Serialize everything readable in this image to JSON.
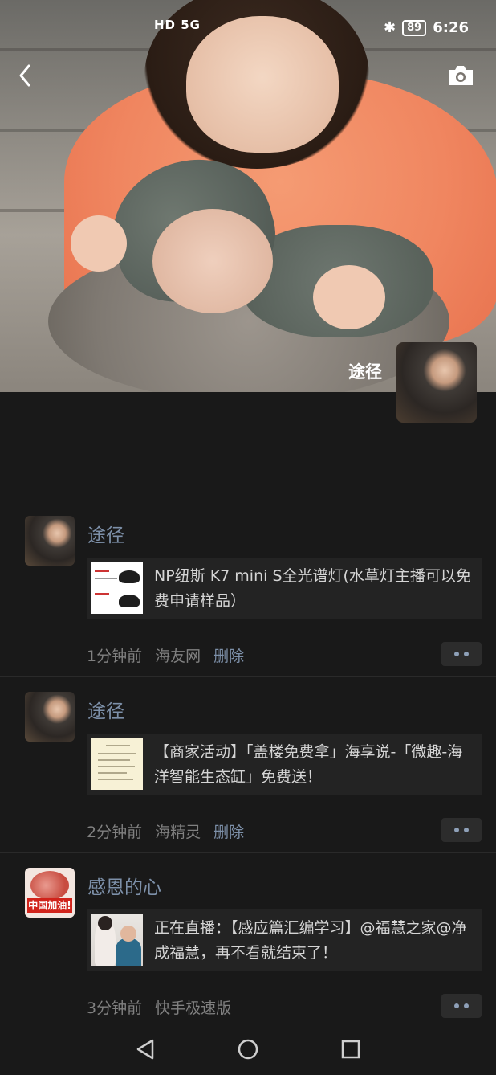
{
  "status_bar": {
    "left": "HD 5G",
    "battery": "89",
    "time": "6:26"
  },
  "cover": {
    "name": "途径"
  },
  "posts": [
    {
      "name": "途径",
      "title": "NP纽斯 K7 mini S全光谱灯(水草灯主播可以免费申请样品）",
      "time": "1分钟前",
      "source": "海友网",
      "delete": "删除"
    },
    {
      "name": "途径",
      "title": "【商家活动】「盖楼免费拿」海享说-「微趣-海洋智能生态缸」免费送！",
      "time": "2分钟前",
      "source": "海精灵",
      "delete": "删除"
    },
    {
      "name": "感恩的心",
      "avatar_text": "中国加油!",
      "title": "正在直播：【感应篇汇编学习】@福慧之家@净成福慧，再不看就结束了！",
      "time": "3分钟前",
      "source": "快手极速版"
    }
  ],
  "icons": {
    "back": "back-arrow-icon",
    "camera": "camera-icon",
    "more": "more-dots-icon",
    "nav_back": "nav-back-icon",
    "nav_home": "nav-home-icon",
    "nav_recent": "nav-recent-icon"
  }
}
